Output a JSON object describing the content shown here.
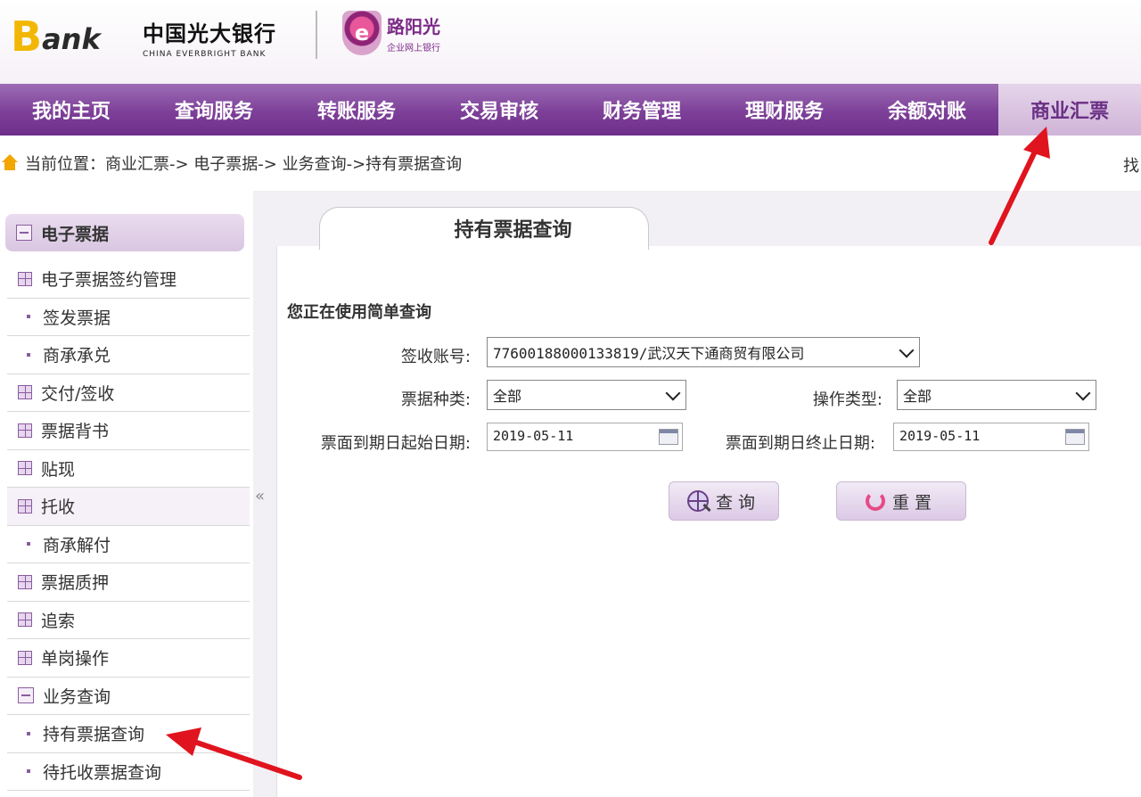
{
  "header": {
    "logo_b": "B",
    "logo_ank": "ank",
    "bank_name_cn": "中国光大银行",
    "bank_name_en": "CHINA EVERBRIGHT BANK",
    "sun_badge": "e",
    "sun_title": "路阳光",
    "sun_subtitle": "企业网上银行"
  },
  "nav": {
    "items": [
      {
        "label": "我的主页"
      },
      {
        "label": "查询服务"
      },
      {
        "label": "转账服务"
      },
      {
        "label": "交易审核"
      },
      {
        "label": "财务管理"
      },
      {
        "label": "理财服务"
      },
      {
        "label": "余额对账"
      },
      {
        "label": "商业汇票"
      }
    ],
    "active": "商业汇票"
  },
  "breadcrumb": {
    "label": "当前位置：",
    "path": "商业汇票-> 电子票据-> 业务查询->持有票据查询",
    "right_text": "找"
  },
  "sidebar": {
    "header": "电子票据",
    "collapse": "«",
    "items": [
      {
        "label": "电子票据签约管理",
        "type": "group"
      },
      {
        "label": "签发票据",
        "type": "sub"
      },
      {
        "label": "商承承兑",
        "type": "sub"
      },
      {
        "label": "交付/签收",
        "type": "group"
      },
      {
        "label": "票据背书",
        "type": "group"
      },
      {
        "label": "贴现",
        "type": "group"
      },
      {
        "label": "托收",
        "type": "group"
      },
      {
        "label": "商承解付",
        "type": "sub"
      },
      {
        "label": "票据质押",
        "type": "group"
      },
      {
        "label": "追索",
        "type": "group"
      },
      {
        "label": "单岗操作",
        "type": "group"
      },
      {
        "label": "业务查询",
        "type": "open"
      },
      {
        "label": "持有票据查询",
        "type": "sub"
      },
      {
        "label": "待托收票据查询",
        "type": "sub"
      }
    ]
  },
  "main": {
    "tab_title": "持有票据查询",
    "subtitle": "您正在使用简单查询",
    "account_label": "签收账号:",
    "account_value": "77600188000133819/武汉天下通商贸有限公司",
    "bill_type_label": "票据种类:",
    "bill_type_value": "全部",
    "op_type_label": "操作类型:",
    "op_type_value": "全部",
    "start_label": "票面到期日起始日期:",
    "start_value": "2019-05-11",
    "end_label": "票面到期日终止日期:",
    "end_value": "2019-05-11",
    "query_button": "查询",
    "reset_button": "重置"
  },
  "colors": {
    "nav_purple": "#7d3f98",
    "arrow_red": "#e0141e",
    "logo_yellow": "#f2b705"
  }
}
